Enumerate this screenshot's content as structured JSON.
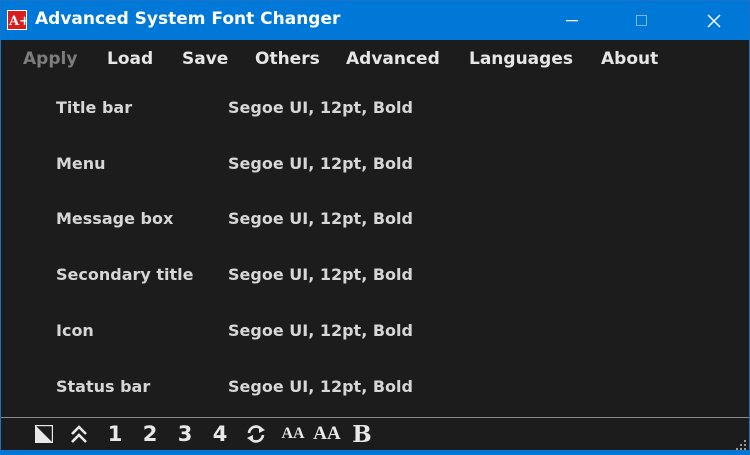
{
  "window": {
    "title": "Advanced System Font Changer",
    "app_icon_text": "A+",
    "colors": {
      "titlebar": "#0078d7",
      "background": "#1c1c1c",
      "text": "#d6d6d6",
      "disabled": "#7d7d7d"
    }
  },
  "menu": {
    "items": [
      {
        "label": "Apply",
        "enabled": false
      },
      {
        "label": "Load",
        "enabled": true
      },
      {
        "label": "Save",
        "enabled": true
      },
      {
        "label": "Others",
        "enabled": true
      },
      {
        "label": "Advanced",
        "enabled": true
      },
      {
        "label": "Languages",
        "enabled": true
      },
      {
        "label": "About",
        "enabled": true
      }
    ]
  },
  "font_settings": [
    {
      "label": "Title bar",
      "value": "Segoe UI, 12pt, Bold"
    },
    {
      "label": "Menu",
      "value": "Segoe UI, 12pt, Bold"
    },
    {
      "label": "Message box",
      "value": "Segoe UI, 12pt, Bold"
    },
    {
      "label": "Secondary title",
      "value": "Segoe UI, 12pt, Bold"
    },
    {
      "label": "Icon",
      "value": "Segoe UI, 12pt, Bold"
    },
    {
      "label": "Status bar",
      "value": "Segoe UI, 12pt, Bold"
    }
  ],
  "toolbar": {
    "theme_icon": "contrast-toggle-icon",
    "collapse_icon": "double-chevron-up-icon",
    "preset_1": "1",
    "preset_2": "2",
    "preset_3": "3",
    "preset_4": "4",
    "refresh_icon": "refresh-icon",
    "small_aa": "AA",
    "large_aa": "AA",
    "bold": "B"
  }
}
